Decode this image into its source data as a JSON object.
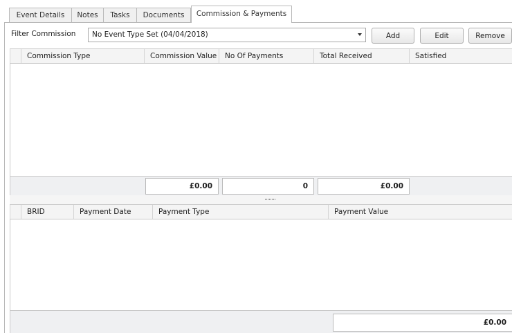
{
  "tabs": [
    {
      "label": "Event Details"
    },
    {
      "label": "Notes"
    },
    {
      "label": "Tasks"
    },
    {
      "label": "Documents"
    },
    {
      "label": "Commission & Payments",
      "active": true
    }
  ],
  "filter": {
    "label": "Filter Commission",
    "selected": "No Event Type Set (04/04/2018)"
  },
  "buttons": {
    "add": "Add",
    "edit": "Edit",
    "remove": "Remove"
  },
  "commission_grid": {
    "columns": [
      "Commission Type",
      "Commission Value",
      "No Of Payments",
      "Total Received",
      "Satisfied"
    ],
    "rows": [],
    "totals": {
      "commission_value": "£0.00",
      "no_of_payments": "0",
      "total_received": "£0.00"
    }
  },
  "payment_grid": {
    "columns": [
      "BRID",
      "Payment Date",
      "Payment Type",
      "Payment Value"
    ],
    "rows": [],
    "totals": {
      "payment_value": "£0.00"
    }
  }
}
